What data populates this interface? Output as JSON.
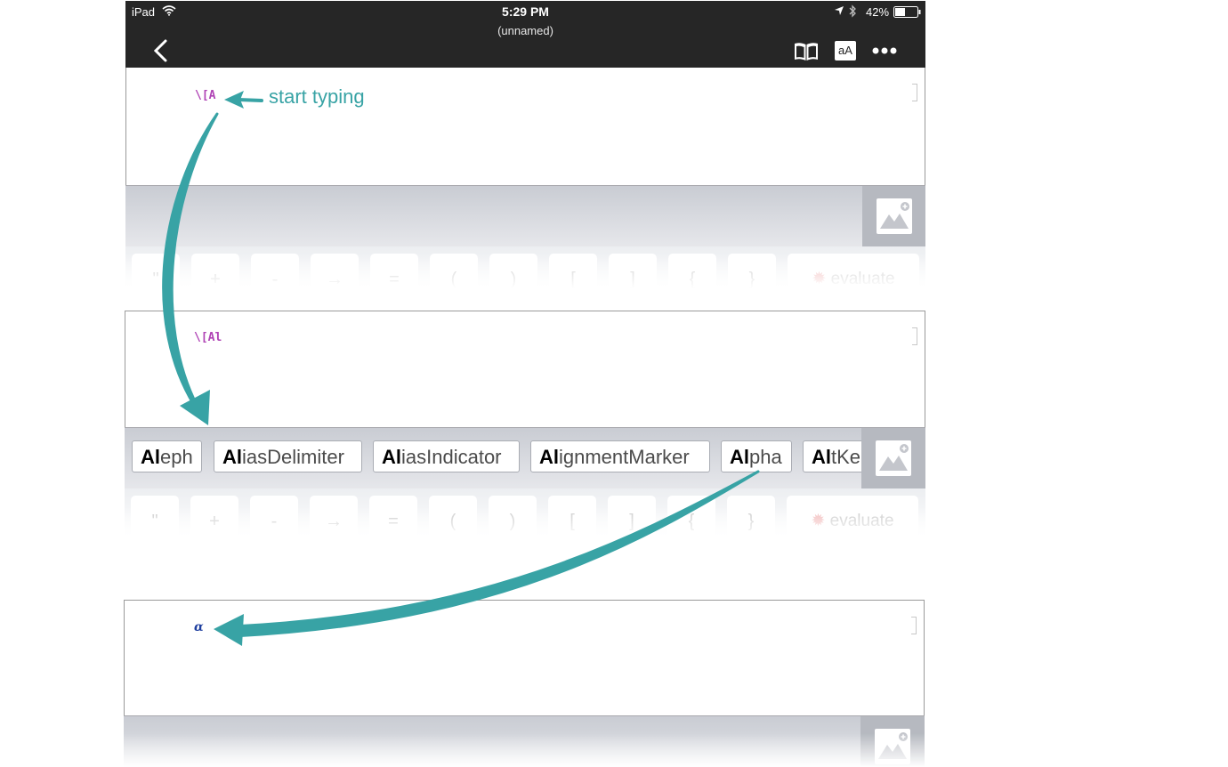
{
  "status_bar": {
    "device": "iPad",
    "time": "5:29 PM",
    "battery": "42%"
  },
  "nav": {
    "title": "(unnamed)",
    "text_size_label": "aA"
  },
  "panels": [
    {
      "input": "\\[A",
      "annotation": "start typing"
    },
    {
      "input": "\\[Al"
    },
    {
      "input": "α"
    }
  ],
  "suggestions": [
    {
      "match": "Al",
      "rest": "eph"
    },
    {
      "match": "Al",
      "rest": "iasDelimiter"
    },
    {
      "match": "Al",
      "rest": "iasIndicator"
    },
    {
      "match": "Al",
      "rest": "ignmentMarker"
    },
    {
      "match": "Al",
      "rest": "pha"
    },
    {
      "match": "Al",
      "rest": "tKe"
    }
  ],
  "keys": [
    "\"",
    "+",
    "-",
    "→",
    "=",
    "(",
    ")",
    "[",
    "]",
    "{",
    "}"
  ],
  "evaluate_label": "evaluate",
  "colors": {
    "accent_teal": "#38a3a5",
    "input_purple": "#b044b5",
    "result_blue": "#1f3f9f",
    "topbar": "#262626"
  }
}
